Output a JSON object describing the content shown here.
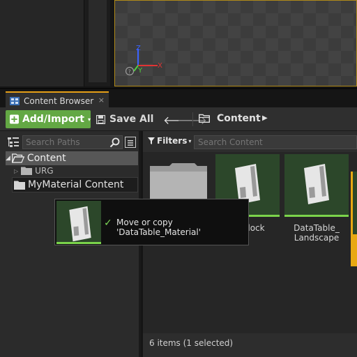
{
  "viewport": {
    "axes": {
      "z": "Z",
      "y": "Y",
      "x": "X",
      "help": "?"
    },
    "axis_colors": {
      "z": "#3b63ff",
      "y": "#52d13d",
      "x": "#e03434"
    }
  },
  "tab": {
    "title": "Content Browser",
    "close": "×",
    "icon": "content-browser-icon"
  },
  "toolbar": {
    "add_import_label": "Add/Import",
    "add_import_arrow": "▾",
    "save_all_label": "Save All",
    "back_arrow": "🡐",
    "forward_arrow": "🡒",
    "breadcrumb": "Content",
    "breadcrumb_arrow": "▶"
  },
  "sources": {
    "search_placeholder": "Search Paths",
    "tree": [
      {
        "label": "Content",
        "expander": "◢"
      },
      {
        "label": "URG",
        "expander": "▷"
      }
    ],
    "drop_target_label": "MyMaterial Content"
  },
  "assets": {
    "filters_label": "Filters",
    "filters_arrow": "▾",
    "search_placeholder": "Search Content",
    "tiles": [
      {
        "name": "",
        "kind": "folder"
      },
      {
        "name": "le_Block",
        "kind": "datatable"
      },
      {
        "name": "DataTable_\nLandscape",
        "kind": "datatable"
      }
    ],
    "status": "6 items (1 selected)"
  },
  "drag_tooltip": {
    "check": "✓",
    "message": "Move or copy 'DataTable_Material'"
  },
  "colors": {
    "accent": "#e59f17",
    "add_button": "#63a844",
    "asset_thumb": "#2c472a",
    "asset_bar": "#7bd44b"
  }
}
